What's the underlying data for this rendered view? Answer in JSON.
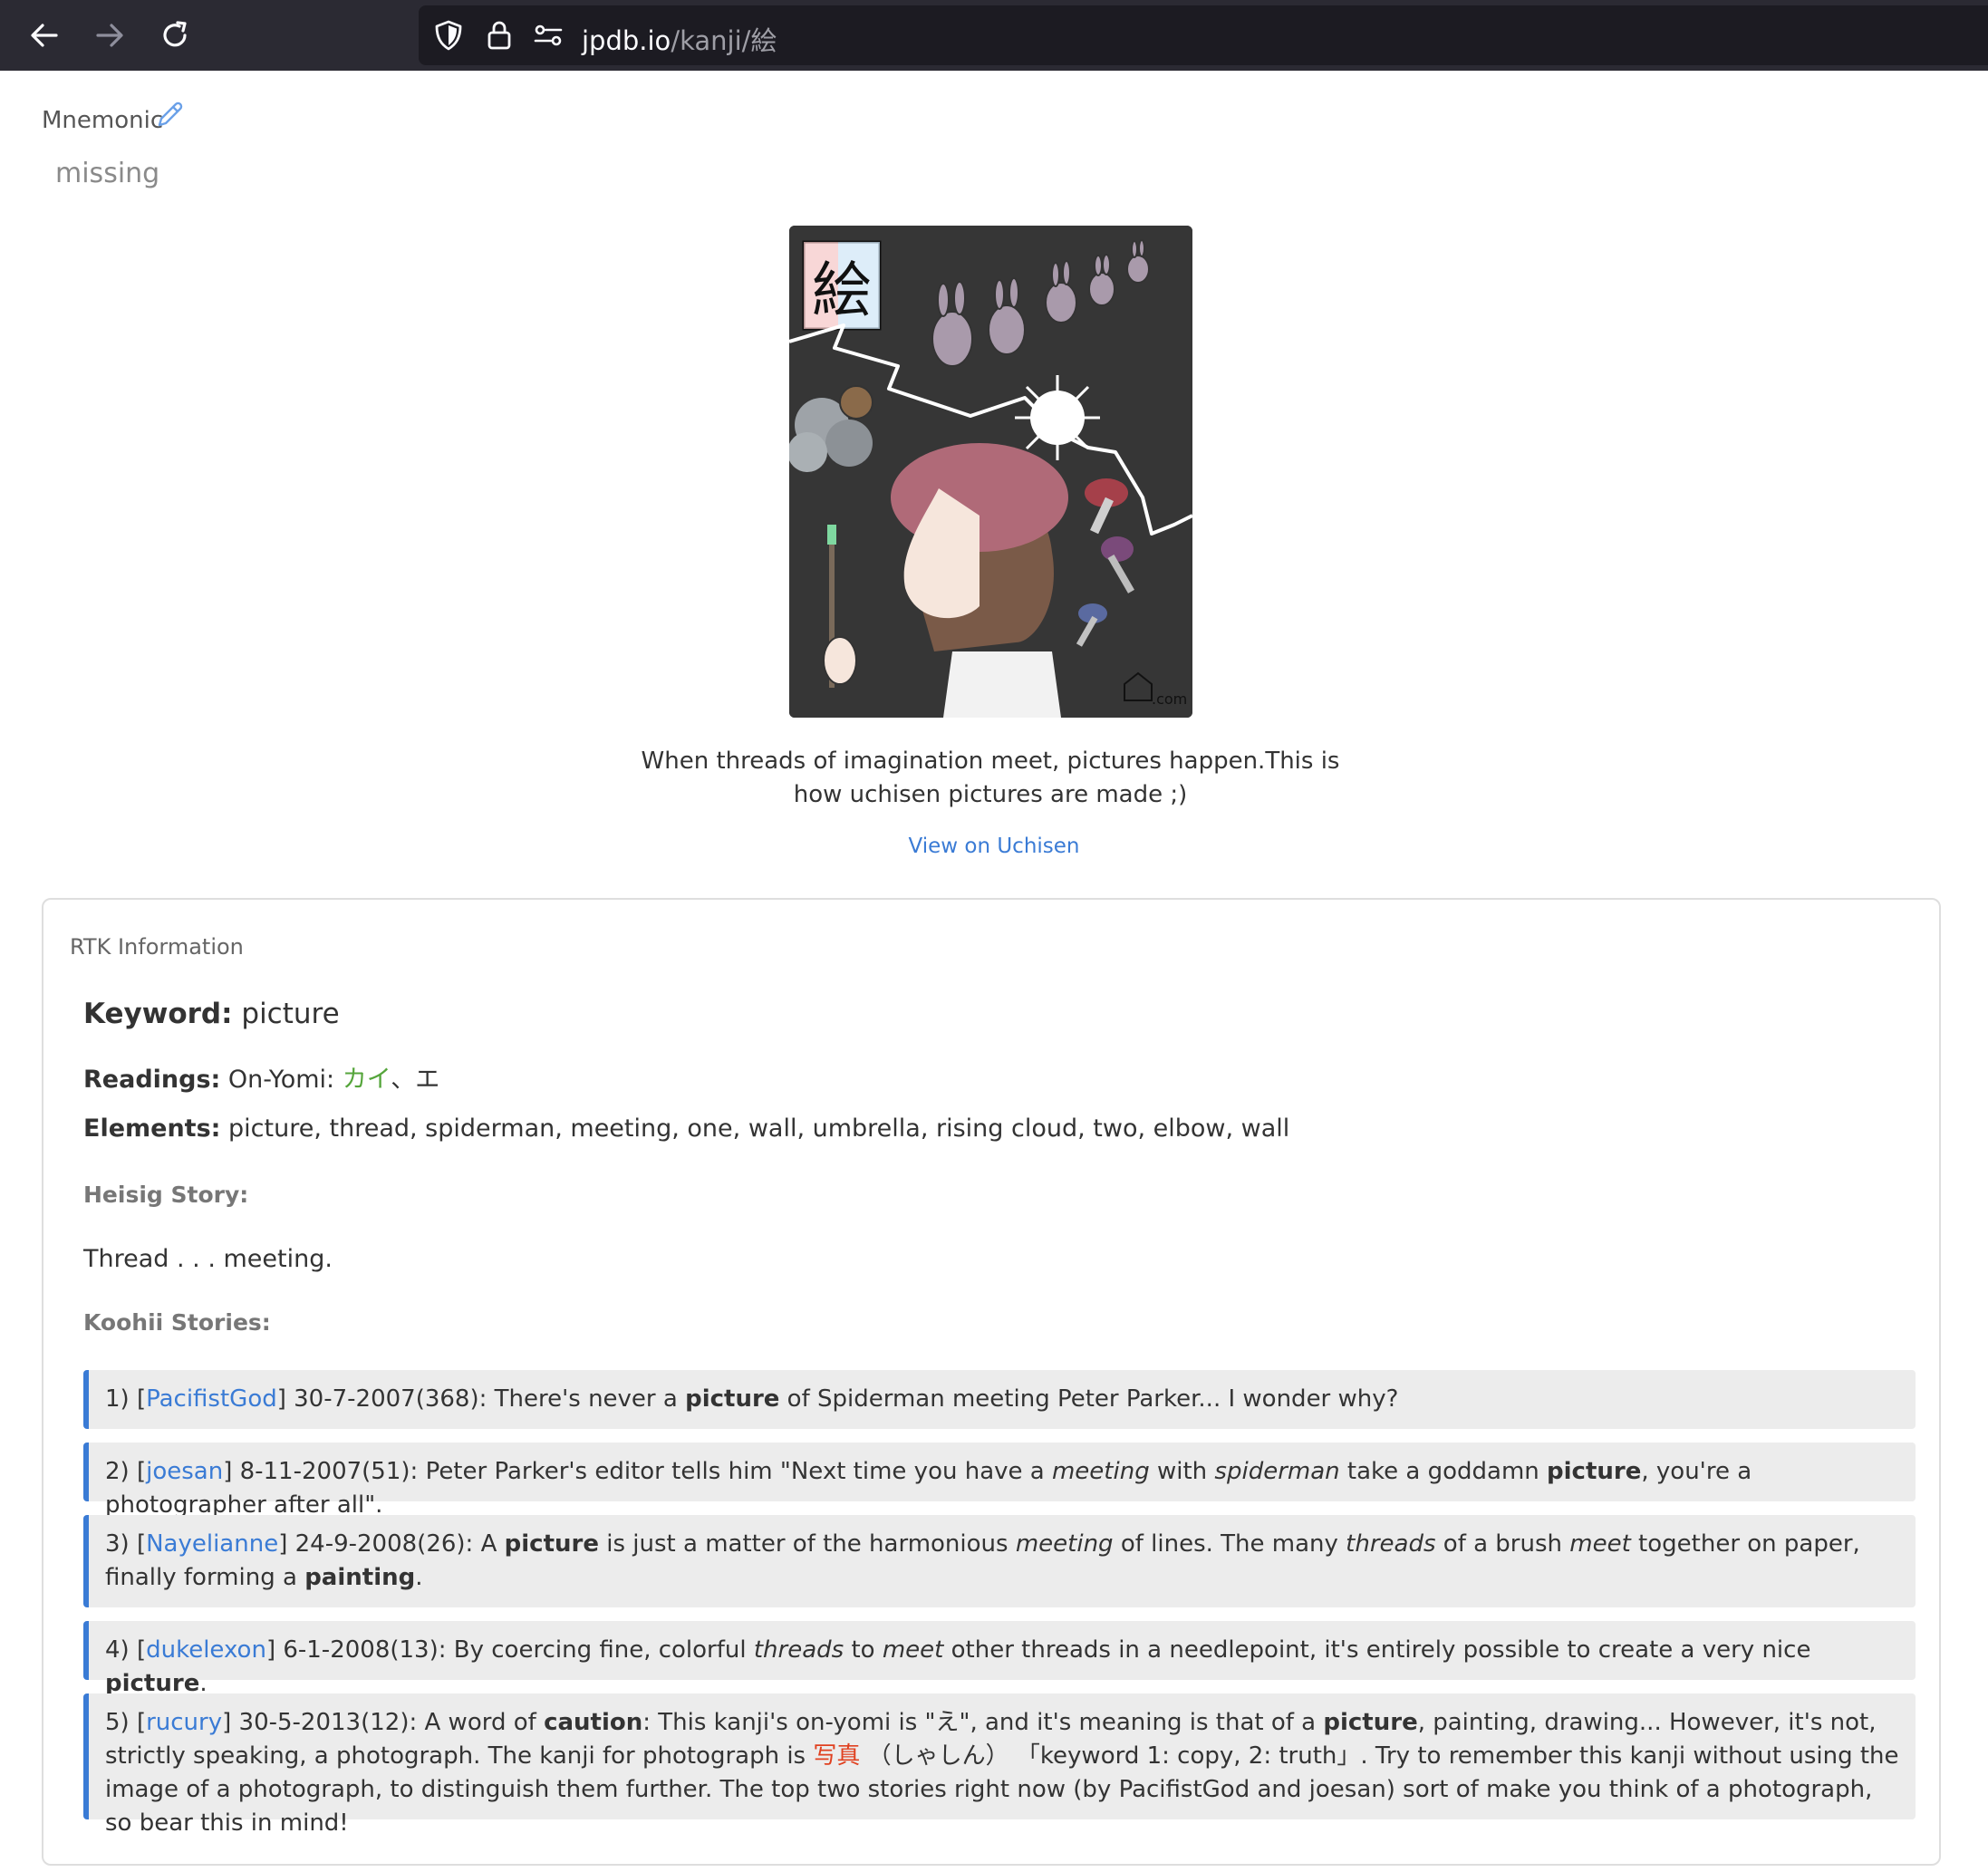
{
  "browser": {
    "url_host": "jpdb.io",
    "url_path": "/kanji/絵",
    "icons": [
      "back-arrow-icon",
      "forward-arrow-icon",
      "reload-icon",
      "shield-icon",
      "lock-icon",
      "site-permissions-icon"
    ]
  },
  "mnemonic": {
    "label": "Mnemonic",
    "value": "missing"
  },
  "illustration": {
    "kanji": "絵",
    "watermark": ".com"
  },
  "caption": "When threads of imagination meet, pictures happen.This is how uchisen pictures are made ;)",
  "view_link": "View on Uchisen",
  "rtk": {
    "title": "RTK Information",
    "keyword_label": "Keyword:",
    "keyword": "picture",
    "readings_label": "Readings:",
    "on_yomi_label": "On-Yomi:",
    "on_yomi_kana": "カイ",
    "on_yomi_rest": "、エ",
    "elements_label": "Elements:",
    "elements": "picture, thread, spiderman, meeting, one, wall, umbrella, rising cloud, two, elbow, wall",
    "heisig_label": "Heisig Story:",
    "heisig_story": "Thread . . . meeting.",
    "koohii_label": "Koohii Stories:",
    "stories": [
      {
        "num": "1) [",
        "user": "PacifistGod",
        "meta": "] 30-7-2007(368): "
      },
      {
        "num": "2) [",
        "user": "joesan",
        "meta": "] 8-11-2007(51): "
      },
      {
        "num": "3) [",
        "user": "Nayelianne",
        "meta": "] 24-9-2008(26): "
      },
      {
        "num": "4) [",
        "user": "dukelexon",
        "meta": "] 6-1-2008(13): "
      },
      {
        "num": "5) [",
        "user": "rucury",
        "meta": "] 30-5-2013(12): "
      }
    ],
    "story_text": {
      "s1_a": "There's never a ",
      "s1_b": "picture",
      "s1_c": " of Spiderman meeting Peter Parker... I wonder why?",
      "s2_a": "Peter Parker's editor tells him \"Next time you have a ",
      "s2_b": "meeting",
      "s2_c": " with ",
      "s2_d": "spiderman",
      "s2_e": " take a goddamn ",
      "s2_f": "picture",
      "s2_g": ", you're a photographer after all\".",
      "s3_a": "A ",
      "s3_b": "picture",
      "s3_c": " is just a matter of the harmonious ",
      "s3_d": "meeting",
      "s3_e": " of lines. The many ",
      "s3_f": "threads",
      "s3_g": " of a brush ",
      "s3_h": "meet",
      "s3_i": " together on paper, finally forming a ",
      "s3_j": "painting",
      "s3_k": ".",
      "s4_a": "By coercing fine, colorful ",
      "s4_b": "threads",
      "s4_c": " to ",
      "s4_d": "meet",
      "s4_e": " other threads in a needlepoint, it's entirely possible to create a very nice ",
      "s4_f": "picture",
      "s4_g": ".",
      "s5_a": "A word of ",
      "s5_b": "caution",
      "s5_c": ": This kanji's on-yomi is \"え\", and it's meaning is that of a ",
      "s5_d": "picture",
      "s5_e": ", painting, drawing... However, it's not, strictly speaking, a photograph. The kanji for photograph is ",
      "s5_f": "写真",
      "s5_g": " （しゃしん） 「keyword 1: copy, 2: truth」. Try to remember this kanji without using the image of a photograph, to distinguish them further. The top two stories right now (by PacifistGod and joesan) sort of make you think of a photograph, so bear this in mind!"
    }
  }
}
